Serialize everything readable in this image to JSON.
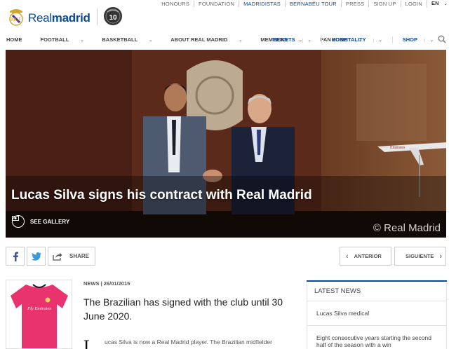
{
  "brand": {
    "real": "Real",
    "madrid": "madrid",
    "badge": "10"
  },
  "toplinks": [
    {
      "label": "HONOURS"
    },
    {
      "label": "FOUNDATION"
    },
    {
      "label": "MADRIDISTAS"
    },
    {
      "label": "BERNABÉU TOUR"
    },
    {
      "label": "PRESS"
    },
    {
      "label": "SIGN UP"
    },
    {
      "label": "LOGIN"
    },
    {
      "label": "EN"
    }
  ],
  "nav": {
    "left": [
      "HOME",
      "FOOTBALL",
      "BASKETBALL",
      "ABOUT REAL MADRID",
      "MEMBERS",
      "FAN ZONE"
    ],
    "right": [
      "TICKETS",
      "HOSPITALITY",
      "SHOP"
    ]
  },
  "hero": {
    "title": "Lucas Silva signs his contract with Real Madrid",
    "gallery_label": "SEE GALLERY",
    "copyright": "© Real Madrid",
    "plane_text": "Emirates"
  },
  "share": {
    "label": "SHARE"
  },
  "pager": {
    "prev": "ANTERIOR",
    "next": "SIGUIENTE"
  },
  "article": {
    "meta": "NEWS | 26/01/2015",
    "lead": "The Brazilian has signed with the club until 30 June 2020.",
    "dropcap": "L",
    "body": "ucas Silva is now a Real Madrid player. The Brazilian midfielder",
    "shirt_text": "Fly Emirates"
  },
  "sidebar": {
    "heading": "LATEST NEWS",
    "items": [
      {
        "title": "Lucas Silva medical"
      },
      {
        "title": "Eight consecutive years starting the second half of the season with a win"
      }
    ]
  },
  "colors": {
    "brand_blue": "#0a4a9c",
    "shirt_pink": "#e8336e"
  }
}
